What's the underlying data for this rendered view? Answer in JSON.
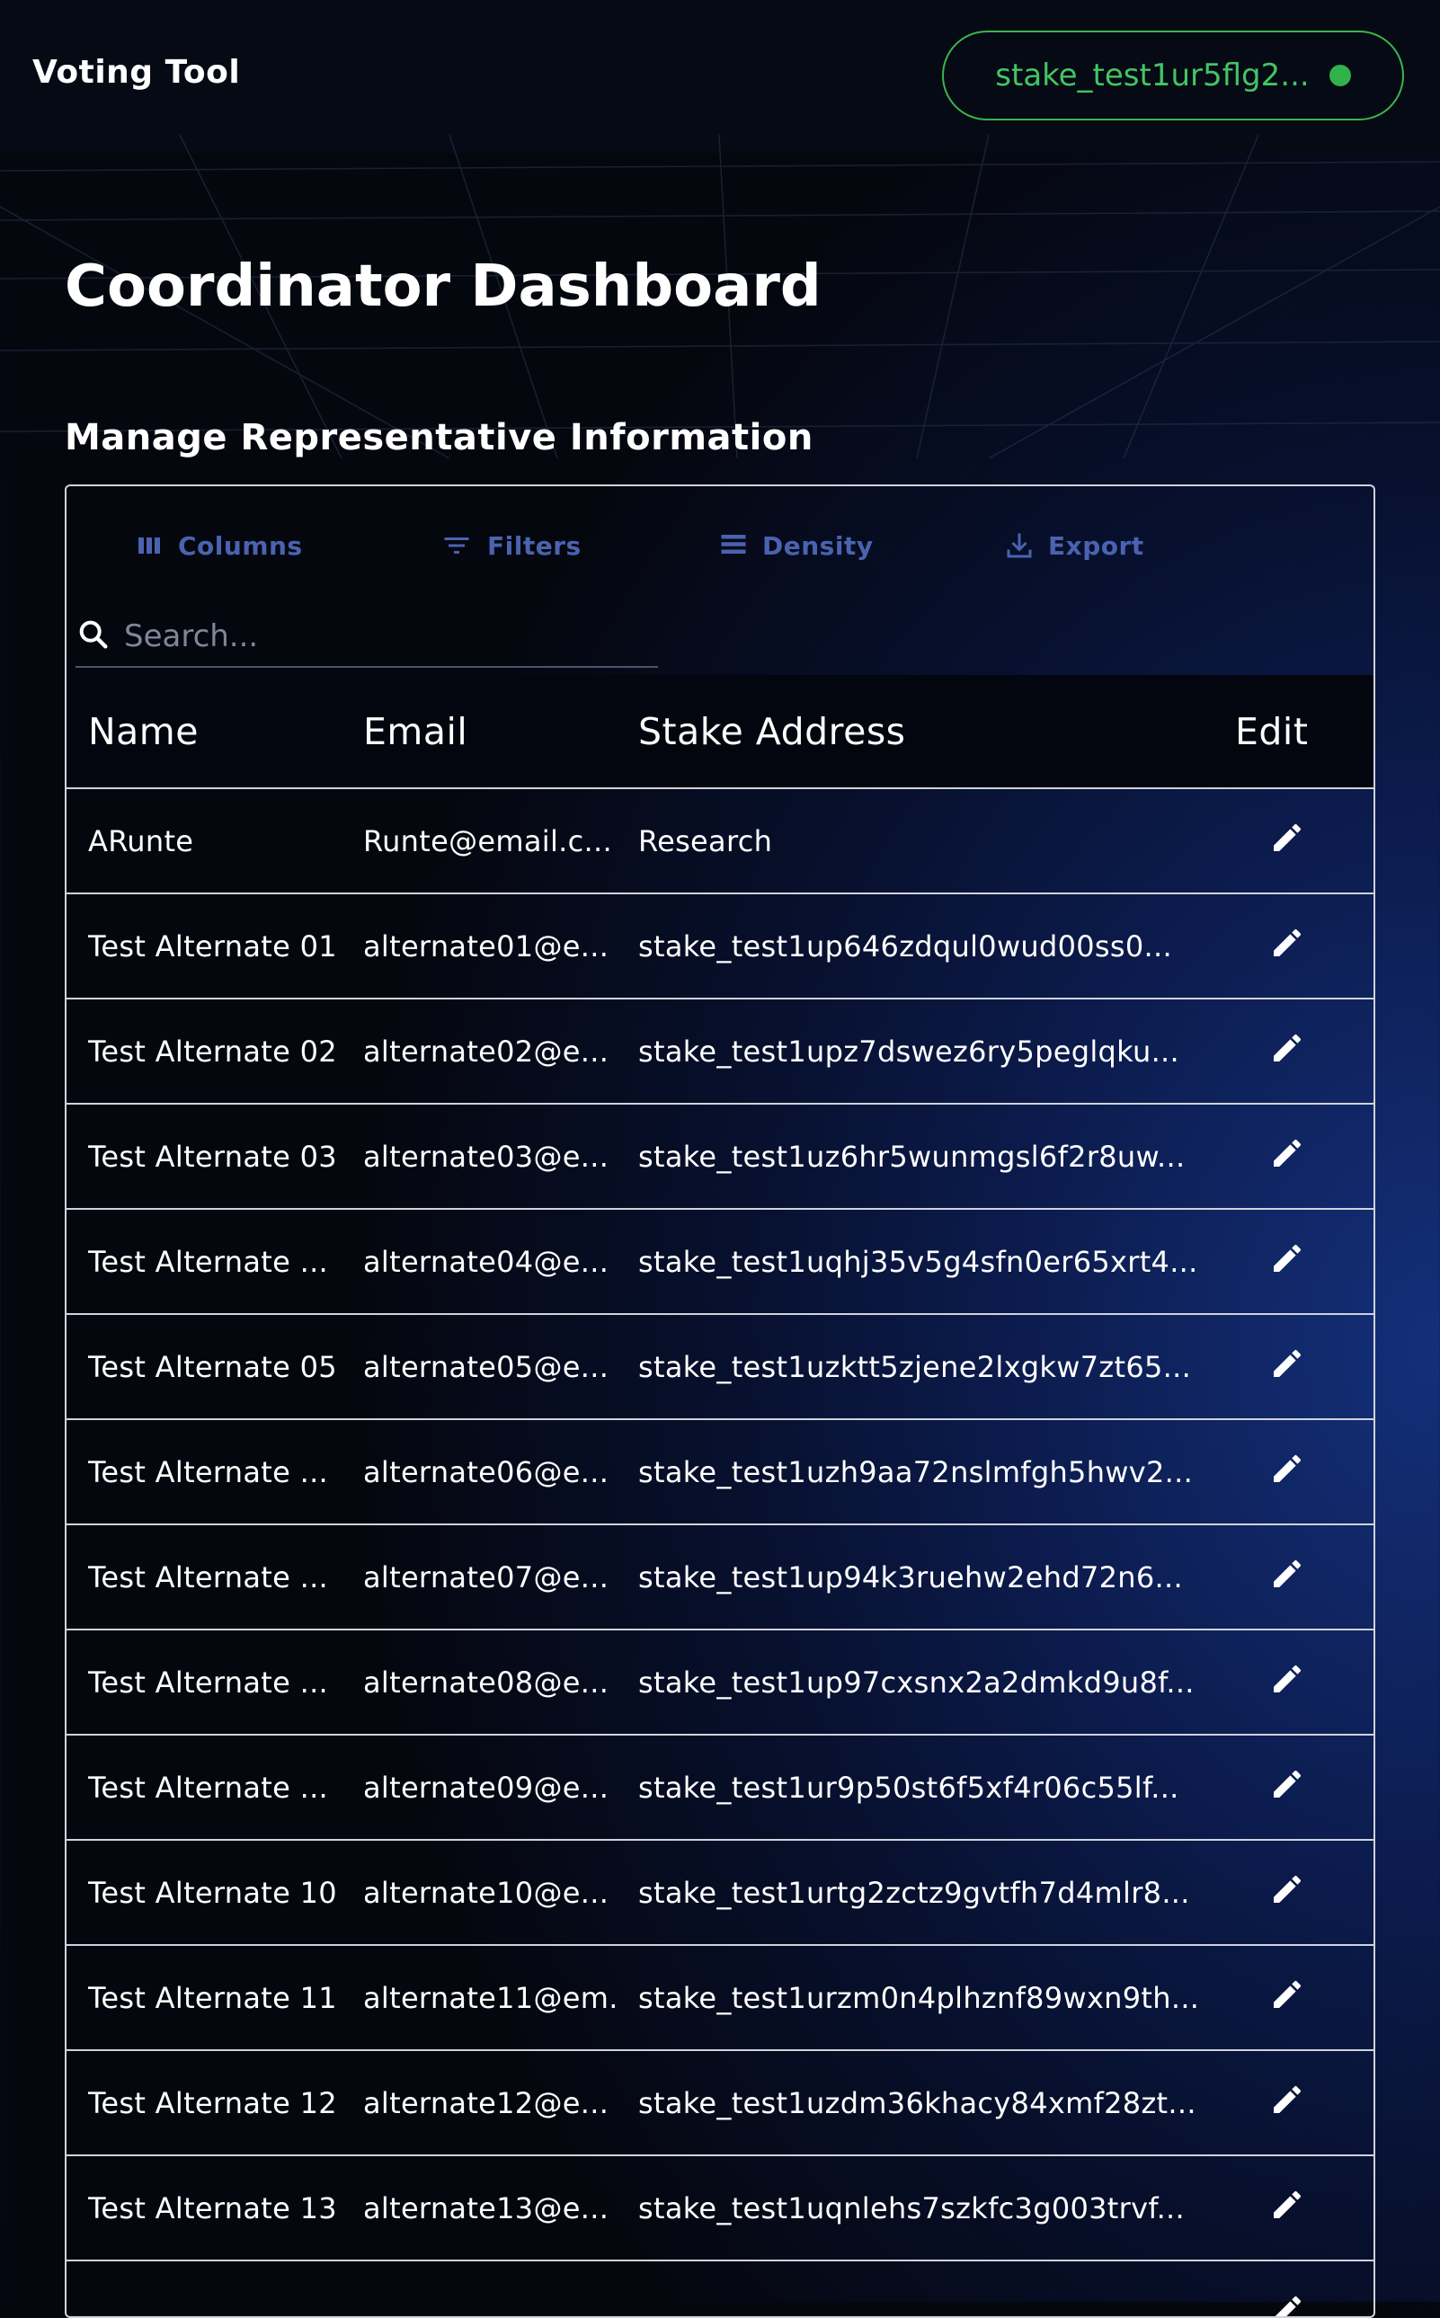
{
  "header": {
    "brand": "Voting Tool",
    "wallet_address": "stake_test1ur5flg2...",
    "wallet_status_color": "#32b24a"
  },
  "page": {
    "title": "Coordinator Dashboard",
    "section_title": "Manage Representative Information"
  },
  "toolbar": {
    "columns_label": "Columns",
    "filters_label": "Filters",
    "density_label": "Density",
    "export_label": "Export",
    "search_placeholder": "Search..."
  },
  "table": {
    "headers": {
      "name": "Name",
      "email": "Email",
      "stake": "Stake Address",
      "edit": "Edit"
    },
    "rows": [
      {
        "name": "ARunte",
        "email": "Runte@email.c...",
        "stake": "Research"
      },
      {
        "name": "Test Alternate 01",
        "email": "alternate01@e...",
        "stake": "stake_test1up646zdqul0wud00ss0..."
      },
      {
        "name": "Test Alternate 02",
        "email": "alternate02@e...",
        "stake": "stake_test1upz7dswez6ry5peglqku..."
      },
      {
        "name": "Test Alternate 03",
        "email": "alternate03@e...",
        "stake": "stake_test1uz6hr5wunmgsl6f2r8uw..."
      },
      {
        "name": "Test Alternate ...",
        "email": "alternate04@e...",
        "stake": "stake_test1uqhj35v5g4sfn0er65xrt4..."
      },
      {
        "name": "Test Alternate 05",
        "email": "alternate05@e...",
        "stake": "stake_test1uzktt5zjene2lxgkw7zt65..."
      },
      {
        "name": "Test Alternate ...",
        "email": "alternate06@e...",
        "stake": "stake_test1uzh9aa72nslmfgh5hwv2..."
      },
      {
        "name": "Test Alternate ...",
        "email": "alternate07@e...",
        "stake": "stake_test1up94k3ruehw2ehd72n6..."
      },
      {
        "name": "Test Alternate ...",
        "email": "alternate08@e...",
        "stake": "stake_test1up97cxsnx2a2dmkd9u8f..."
      },
      {
        "name": "Test Alternate ...",
        "email": "alternate09@e...",
        "stake": "stake_test1ur9p50st6f5xf4r06c55lf..."
      },
      {
        "name": "Test Alternate 10",
        "email": "alternate10@e...",
        "stake": "stake_test1urtg2zctz9gvtfh7d4mlr8..."
      },
      {
        "name": "Test Alternate 11",
        "email": "alternate11@em...",
        "stake": "stake_test1urzm0n4plhznf89wxn9th..."
      },
      {
        "name": "Test Alternate 12",
        "email": "alternate12@e...",
        "stake": "stake_test1uzdm36khacy84xmf28zt..."
      },
      {
        "name": "Test Alternate 13",
        "email": "alternate13@e...",
        "stake": "stake_test1uqnlehs7szkfc3g003trvf..."
      },
      {
        "name": "",
        "email": "",
        "stake": ""
      }
    ]
  },
  "colors": {
    "accent_green": "#3bb54a",
    "toolbar_blue": "#4a63b0",
    "header_row_bg": "#03060f"
  },
  "icons": [
    "columns-icon",
    "filters-icon",
    "density-icon",
    "export-icon",
    "search-icon",
    "edit-pencil-icon"
  ]
}
